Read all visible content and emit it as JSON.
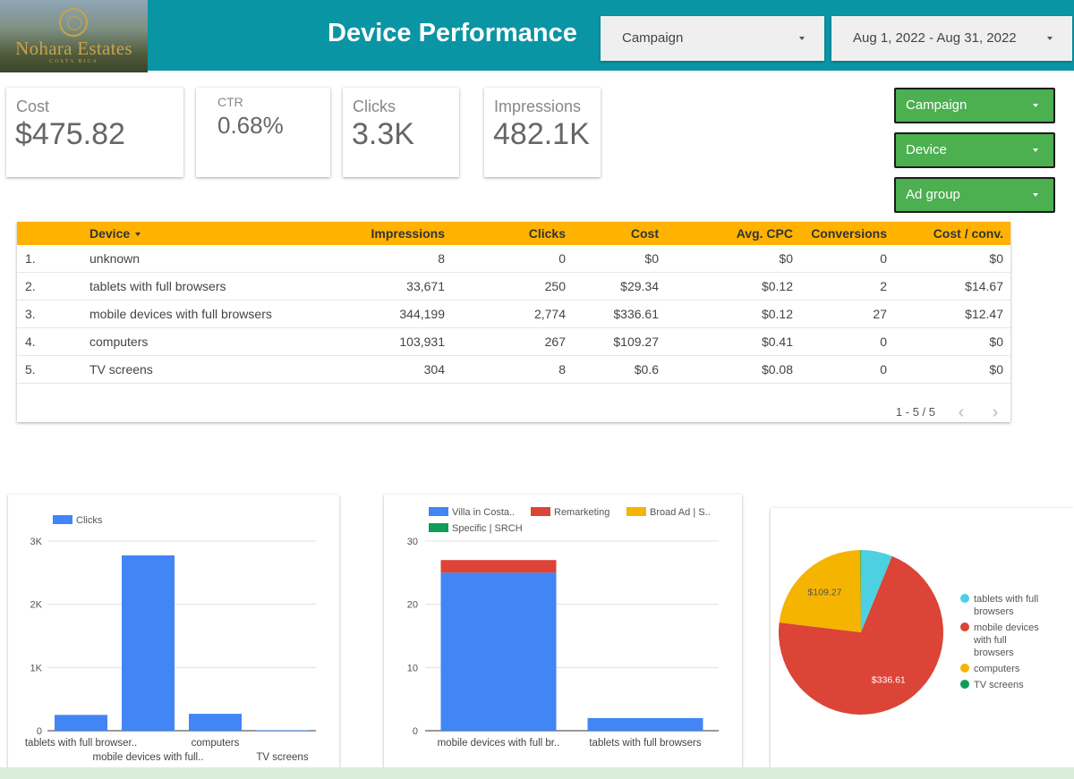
{
  "header": {
    "title": "Device Performance",
    "logo": {
      "brand": "Nohara Estates",
      "sub": "COSTA RICA"
    },
    "campaign_dropdown": "Campaign",
    "date_range": "Aug 1, 2022 - Aug 31, 2022",
    "colors": {
      "bar": "#0a95a5"
    }
  },
  "scorecards": [
    {
      "label": "Cost",
      "value": "$475.82"
    },
    {
      "label": "CTR",
      "value": "0.68%"
    },
    {
      "label": "Clicks",
      "value": "3.3K"
    },
    {
      "label": "Impressions",
      "value": "482.1K"
    }
  ],
  "filters": [
    {
      "label": "Campaign"
    },
    {
      "label": "Device"
    },
    {
      "label": "Ad group"
    }
  ],
  "table": {
    "headers": [
      "Device",
      "Impressions",
      "Clicks",
      "Cost",
      "Avg. CPC",
      "Conversions",
      "Cost / conv."
    ],
    "rows": [
      {
        "n": "1.",
        "device": "unknown",
        "impressions": "8",
        "clicks": "0",
        "cost": "$0",
        "cpc": "$0",
        "conversions": "0",
        "cost_conv": "$0"
      },
      {
        "n": "2.",
        "device": "tablets with full browsers",
        "impressions": "33,671",
        "clicks": "250",
        "cost": "$29.34",
        "cpc": "$0.12",
        "conversions": "2",
        "cost_conv": "$14.67"
      },
      {
        "n": "3.",
        "device": "mobile devices with full browsers",
        "impressions": "344,199",
        "clicks": "2,774",
        "cost": "$336.61",
        "cpc": "$0.12",
        "conversions": "27",
        "cost_conv": "$12.47"
      },
      {
        "n": "4.",
        "device": "computers",
        "impressions": "103,931",
        "clicks": "267",
        "cost": "$109.27",
        "cpc": "$0.41",
        "conversions": "0",
        "cost_conv": "$0"
      },
      {
        "n": "5.",
        "device": "TV screens",
        "impressions": "304",
        "clicks": "8",
        "cost": "$0.6",
        "cpc": "$0.08",
        "conversions": "0",
        "cost_conv": "$0"
      }
    ],
    "pagination": "1 - 5 / 5",
    "header_color": "#ffb300"
  },
  "chart_data": [
    {
      "type": "bar",
      "legend": "top-left",
      "series": [
        {
          "name": "Clicks",
          "color": "#4285f4",
          "values": [
            250,
            2774,
            267,
            8
          ]
        }
      ],
      "categories": [
        "tablets with full browsers",
        "mobile devices with full browsers",
        "computers",
        "TV screens"
      ],
      "tick_labels": [
        "tablets with full browser..",
        "mobile devices with full..",
        "computers",
        "TV screens"
      ],
      "ylim": [
        0,
        3000
      ],
      "yticks": [
        "0",
        "1K",
        "2K",
        "3K"
      ],
      "grid": true
    },
    {
      "type": "bar",
      "stacked": true,
      "legend": "top",
      "legend_labels": [
        "Villa in Costa..",
        "Remarketing",
        "Broad Ad | S..",
        "Specific | SRCH"
      ],
      "series": [
        {
          "name": "Villa in Costa..",
          "color": "#4285f4",
          "values": [
            25,
            2
          ]
        },
        {
          "name": "Remarketing",
          "color": "#db4437",
          "values": [
            2,
            0
          ]
        },
        {
          "name": "Broad Ad | S..",
          "color": "#f4b400",
          "values": [
            0,
            0
          ]
        },
        {
          "name": "Specific | SRCH",
          "color": "#0f9d58",
          "values": [
            0,
            0
          ]
        }
      ],
      "categories": [
        "mobile devices with full browsers",
        "tablets with full browsers"
      ],
      "tick_labels": [
        "mobile devices with full br..",
        "tablets with full browsers"
      ],
      "ylim": [
        0,
        30
      ],
      "yticks": [
        "0",
        "10",
        "20",
        "30"
      ],
      "grid": true
    },
    {
      "type": "pie",
      "legend": "right",
      "slices": [
        {
          "label": "tablets with full browsers",
          "legend_lines": [
            "tablets with full",
            "browsers"
          ],
          "value": 29.34,
          "color": "#4dd0e1",
          "data_label": ""
        },
        {
          "label": "mobile devices with full browsers",
          "legend_lines": [
            "mobile devices",
            "with full",
            "browsers"
          ],
          "value": 336.61,
          "color": "#db4437",
          "data_label": "$336.61"
        },
        {
          "label": "computers",
          "legend_lines": [
            "computers"
          ],
          "value": 109.27,
          "color": "#f4b400",
          "data_label": "$109.27"
        },
        {
          "label": "TV screens",
          "legend_lines": [
            "TV screens"
          ],
          "value": 0.6,
          "color": "#0f9d58",
          "data_label": ""
        }
      ]
    }
  ]
}
